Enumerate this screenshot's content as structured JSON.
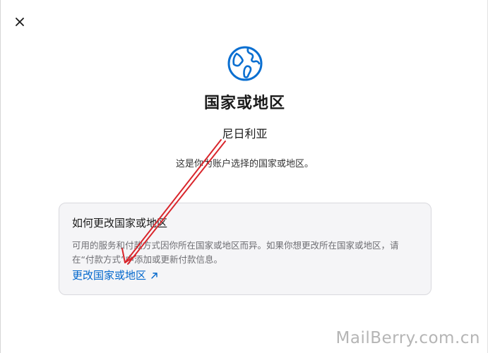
{
  "header": {
    "close_icon": "close-icon"
  },
  "hero": {
    "icon": "globe-icon",
    "title": "国家或地区",
    "country": "尼日利亚",
    "description": "这是你为账户选择的国家或地区。"
  },
  "info_card": {
    "title": "如何更改国家或地区",
    "body": "可用的服务和付款方式因你所在国家或地区而异。如果你想更改所在国家或地区，请在“付款方式”中添加或更新付款信息。",
    "link_label": "更改国家或地区",
    "link_icon": "external-link-icon"
  },
  "annotation": {
    "color": "#d9262c"
  },
  "watermark": {
    "text": "MailBerry.com.cn"
  },
  "colors": {
    "accent": "#0066cc",
    "card_background": "#f5f5f7"
  }
}
